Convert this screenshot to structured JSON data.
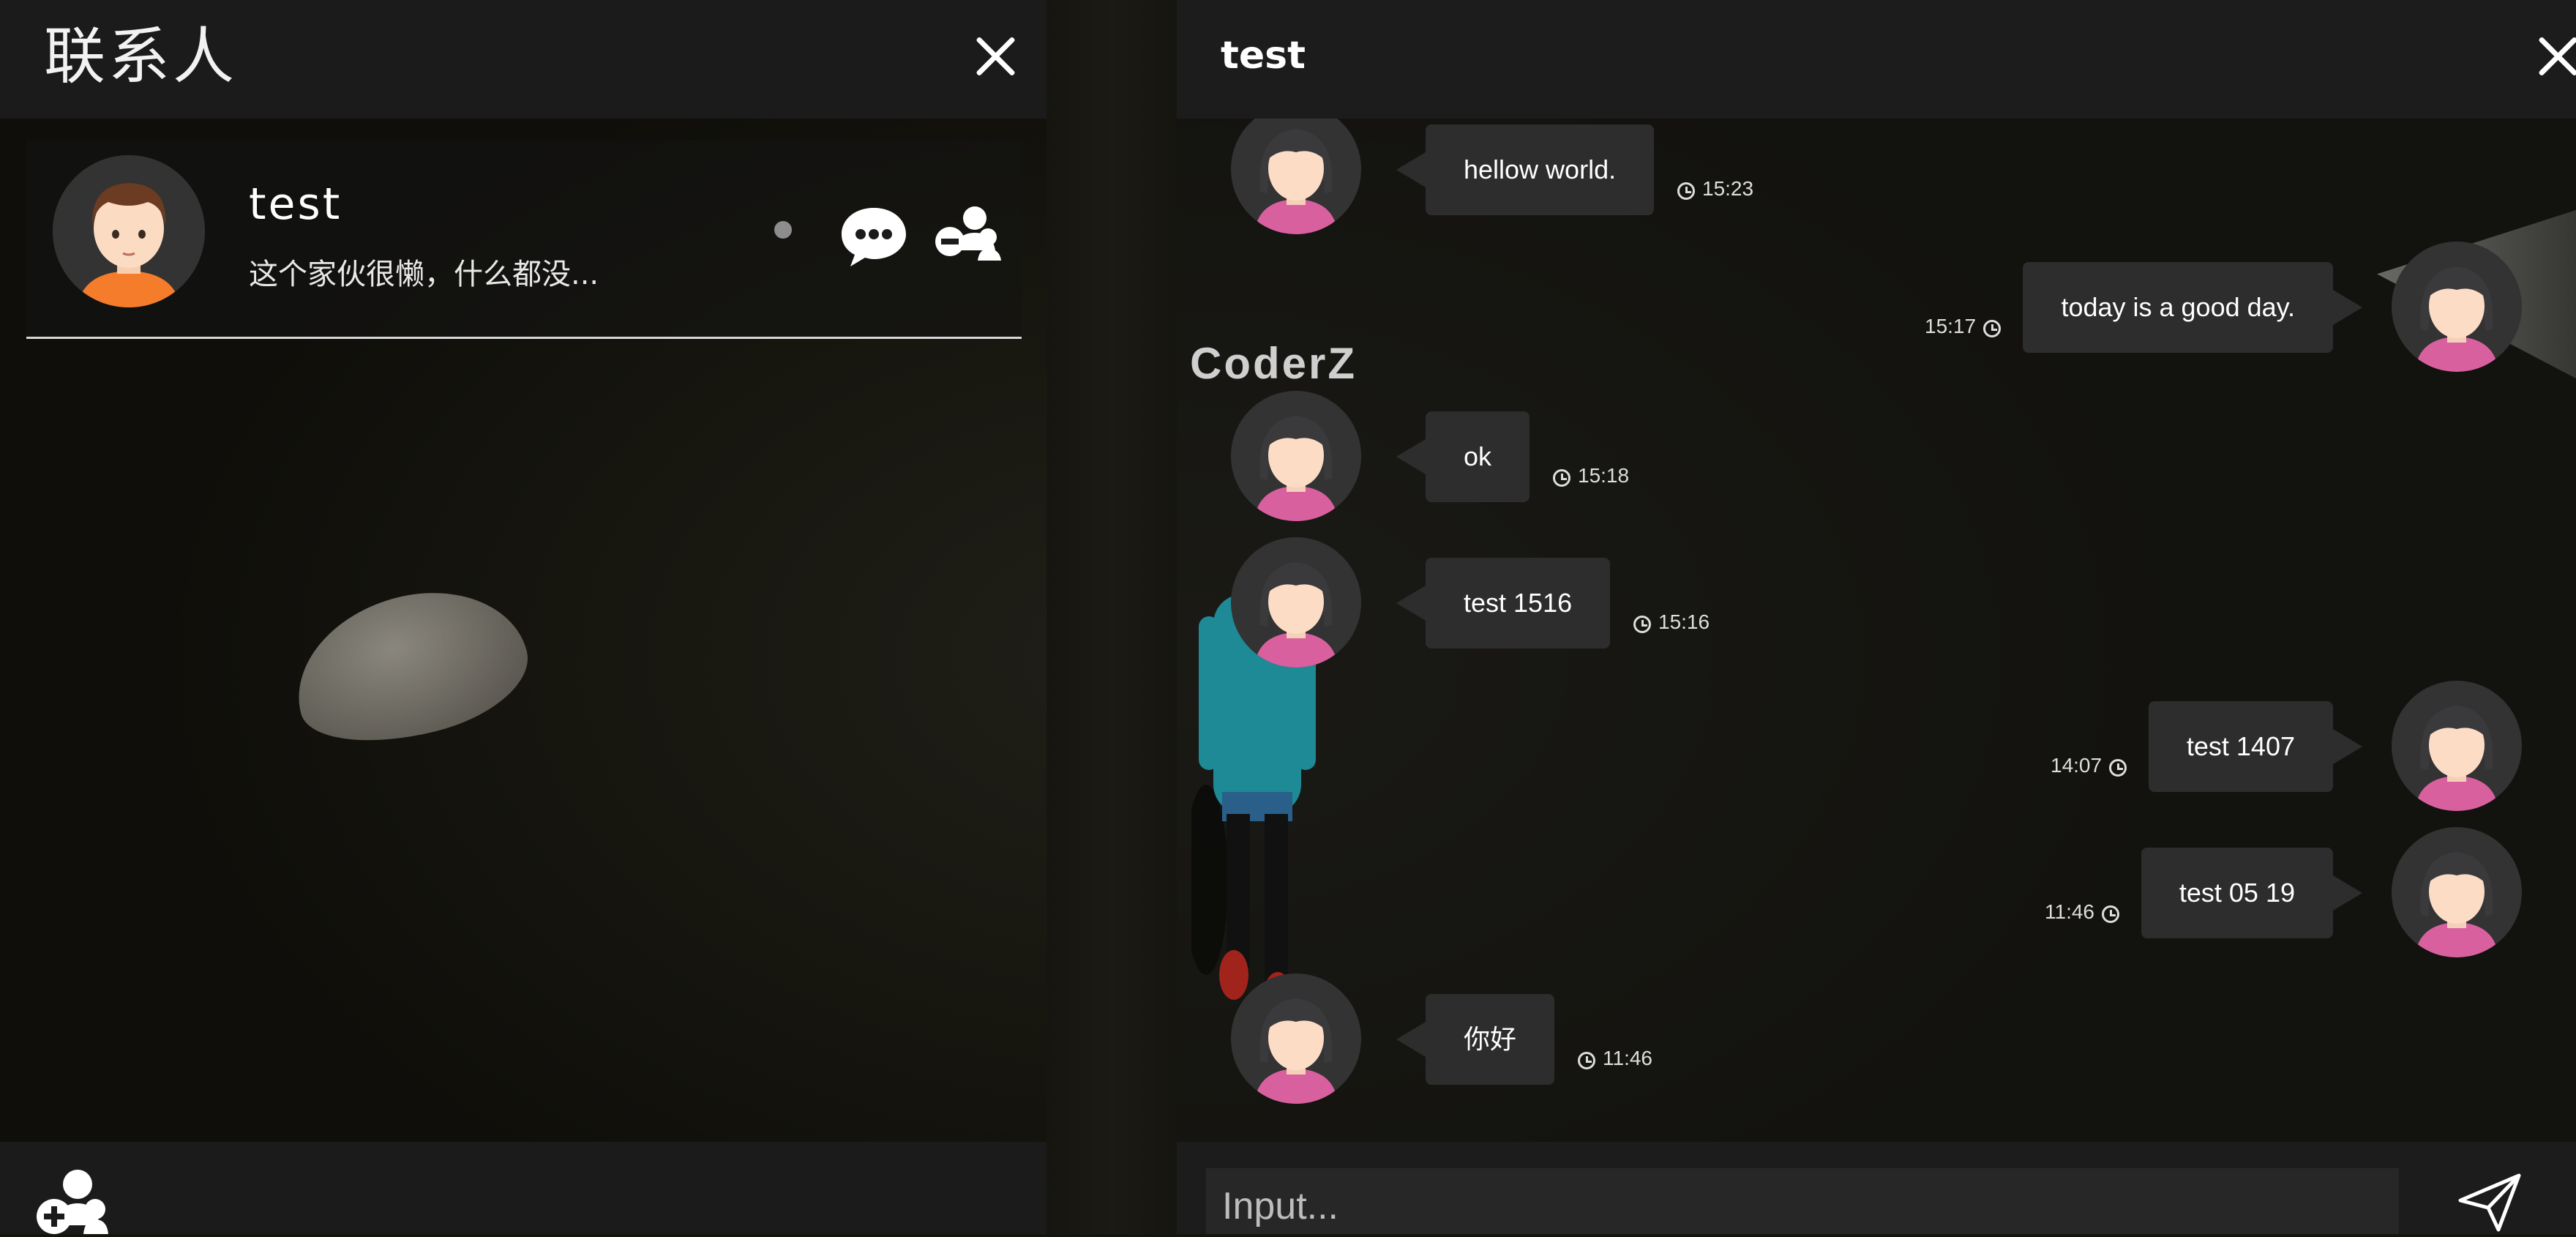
{
  "contacts_panel": {
    "title": "联系人",
    "contact": {
      "name": "test",
      "signature": "这个家伙很懒，什么都没..."
    }
  },
  "chat_panel": {
    "title": "test",
    "scene_label": "CoderZ",
    "messages": [
      {
        "side": "left",
        "text": "hellow world.",
        "time": "15:23"
      },
      {
        "side": "right",
        "text": "today is a good day.",
        "time": "15:17"
      },
      {
        "side": "left",
        "text": "ok",
        "time": "15:18"
      },
      {
        "side": "left",
        "text": "test 1516",
        "time": "15:16"
      },
      {
        "side": "right",
        "text": "test 1407",
        "time": "14:07"
      },
      {
        "side": "right",
        "text": "test 05 19",
        "time": "11:46"
      },
      {
        "side": "left",
        "text": "你好",
        "time": "11:46"
      }
    ],
    "input": {
      "placeholder": "Input..."
    }
  },
  "colors": {
    "panel_bg": "#1c1c1c",
    "bubble_bg": "#2d2d2d",
    "male_avatar_shirt": "#f57c2a",
    "female_avatar_shirt": "#d9609e"
  },
  "icons": {
    "close": "close-icon",
    "chat": "chat-bubble-icon",
    "remove_friend": "remove-friend-icon",
    "add_friend": "add-friend-icon",
    "send": "send-icon",
    "clock": "clock-icon"
  }
}
